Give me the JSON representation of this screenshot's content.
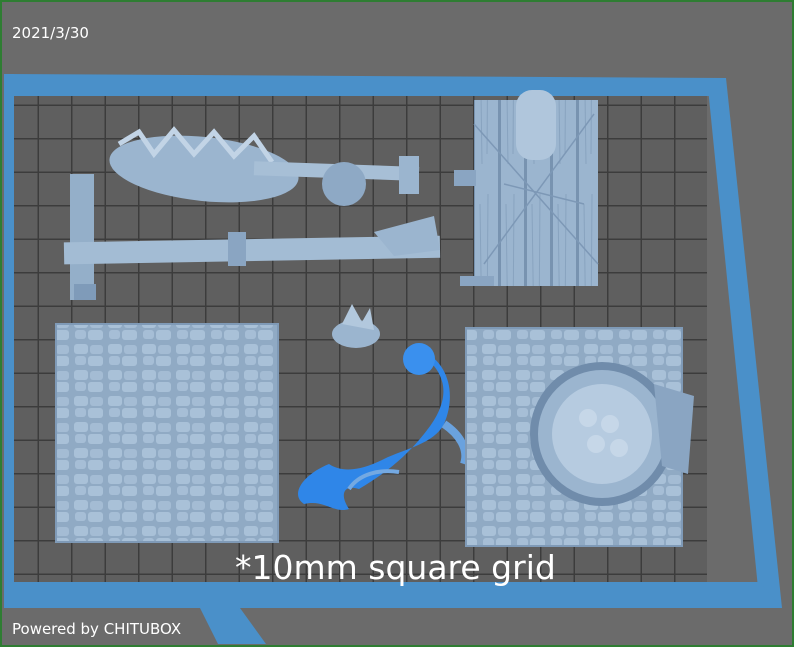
{
  "header": {
    "date": "2021/3/30"
  },
  "footer": {
    "powered_by": "Powered by CHITUBOX"
  },
  "viewport": {
    "caption": "*10mm square grid",
    "colors": {
      "background": "#6b6b6b",
      "grid_cell": "#5f5f5f",
      "grid_line": "#3c3c3c",
      "plate_border": "#4a90c9",
      "model": "#9bb5cf",
      "model_highlight": "#2f86e8"
    },
    "models": [
      {
        "name": "spiked-club",
        "kind": "weapon"
      },
      {
        "name": "wooden-beam-post",
        "kind": "terrain"
      },
      {
        "name": "wooden-table",
        "kind": "terrain"
      },
      {
        "name": "small-rock-base",
        "kind": "base"
      },
      {
        "name": "stone-floor-tile",
        "kind": "terrain"
      },
      {
        "name": "mermaid-figure",
        "kind": "miniature",
        "selected": true
      },
      {
        "name": "barrel-on-stone-tile",
        "kind": "terrain"
      }
    ]
  }
}
